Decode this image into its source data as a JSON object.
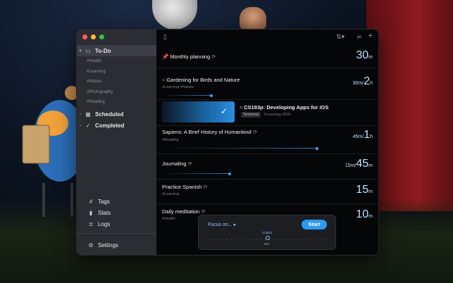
{
  "sidebar": {
    "title": "To-Do",
    "tags": [
      "#Health",
      "#Learning",
      "#Nature",
      "#Photography",
      "#Reading"
    ],
    "scheduled": "Scheduled",
    "completed": "Completed",
    "bottom": [
      "Tags",
      "Stats",
      "Logs"
    ],
    "settings": "Settings"
  },
  "tasks": [
    {
      "title": "Monthly planning",
      "tags": "",
      "dur_big": "30",
      "dur_unit": "m",
      "progress": 0
    },
    {
      "title": "Gardening for Birds and Nature",
      "tags": "#Learning  #Nature",
      "dur_small": "30m/",
      "dur_big": "2",
      "dur_unit": "h",
      "progress": 0.34
    },
    {
      "title": "CS193p: Developing Apps for iOS",
      "tags": "#Learning  #iOS",
      "badge": "Tomorrow"
    },
    {
      "title": "Sapiens: A Brief History of Humankind",
      "tags": "#Reading",
      "dur_small": "45m/",
      "dur_big": "1",
      "dur_unit": "h",
      "progress": 0.72
    },
    {
      "title": "Journaling",
      "tags": "",
      "dur_small": "15m/",
      "dur_big": "45",
      "dur_unit": "m",
      "progress": 0.33
    },
    {
      "title": "Practice Spanish",
      "tags": "#Learning",
      "dur_big": "15",
      "dur_unit": "m",
      "progress": 0
    },
    {
      "title": "Daily meditation",
      "tags": "#Health",
      "dur_big": "10",
      "dur_unit": "m",
      "progress": 0
    }
  ],
  "focus": {
    "prompt": "Focus on...",
    "start": "Start",
    "preset_label": "Critical",
    "minutes": "30m"
  }
}
